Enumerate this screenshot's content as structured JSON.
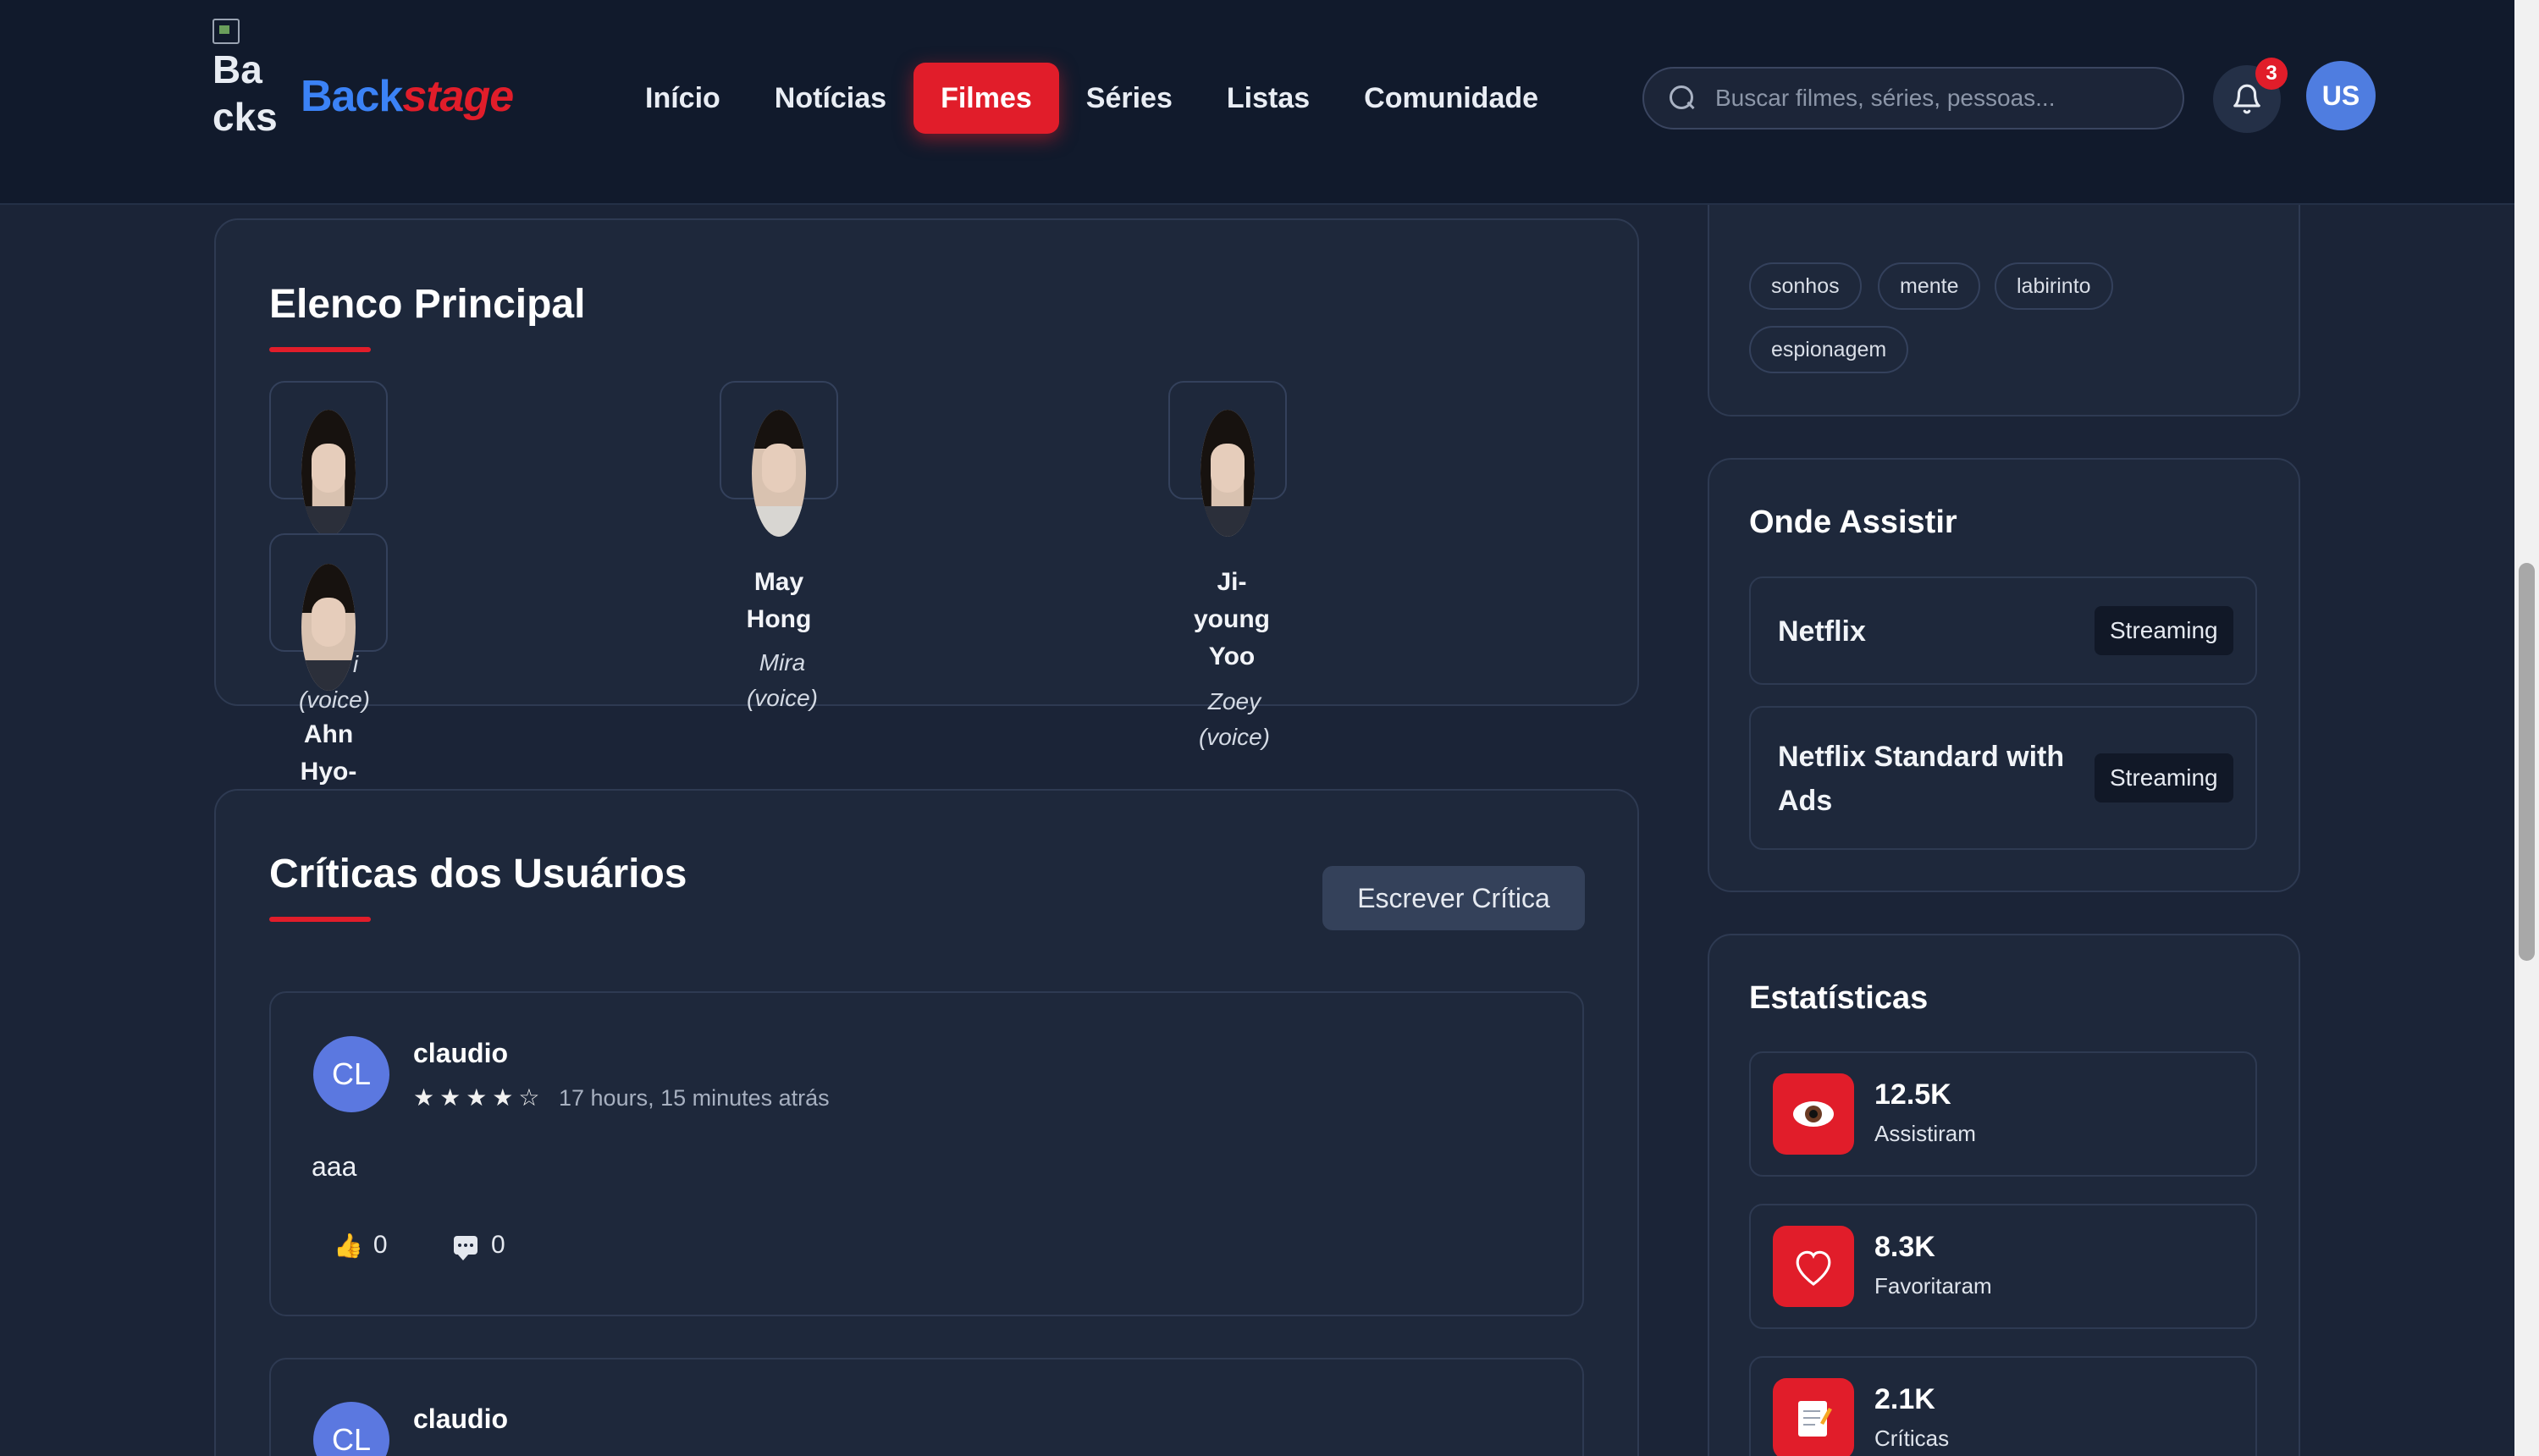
{
  "header": {
    "logo_alt": "Backstage Logo",
    "brand_part1": "Back",
    "brand_part2": "stage",
    "nav": [
      "Início",
      "Notícias",
      "Filmes",
      "Séries",
      "Listas",
      "Comunidade"
    ],
    "active_nav": "Filmes",
    "search_placeholder": "Buscar filmes, séries, pessoas...",
    "notification_count": "3",
    "user_initials": "US"
  },
  "cast": {
    "title": "Elenco Principal",
    "members": [
      {
        "name": "Ahn Hyo-",
        "role": "(voice)",
        "role_fragment": "i"
      },
      {
        "name": "May Hong",
        "role": "Mira (voice)"
      },
      {
        "name": "Ji-young Yoo",
        "role": "Zoey (voice)"
      }
    ]
  },
  "reviews": {
    "title": "Críticas dos Usuários",
    "write_button": "Escrever Crítica",
    "items": [
      {
        "initials": "CL",
        "user": "claudio",
        "stars": "★★★★☆",
        "rating": 4,
        "time": "17 hours, 15 minutes atrás",
        "text": "aaa",
        "likes": "0",
        "comments": "0"
      },
      {
        "initials": "CL",
        "user": "claudio"
      }
    ]
  },
  "keywords": [
    "sonhos",
    "mente",
    "labirinto",
    "espionagem"
  ],
  "where_to_watch": {
    "title": "Onde Assistir",
    "providers": [
      {
        "name": "Netflix",
        "type": "Streaming"
      },
      {
        "name": "Netflix Standard with Ads",
        "type": "Streaming"
      }
    ]
  },
  "stats": {
    "title": "Estatísticas",
    "items": [
      {
        "value": "12.5K",
        "label": "Assistiram",
        "icon": "eye-icon"
      },
      {
        "value": "8.3K",
        "label": "Favoritaram",
        "icon": "heart-icon"
      },
      {
        "value": "2.1K",
        "label": "Críticas",
        "icon": "memo-icon"
      }
    ]
  },
  "colors": {
    "accent": "#e11d2a",
    "brand_blue": "#3b82f6",
    "background": "#1b2437",
    "header": "#111a2c"
  }
}
